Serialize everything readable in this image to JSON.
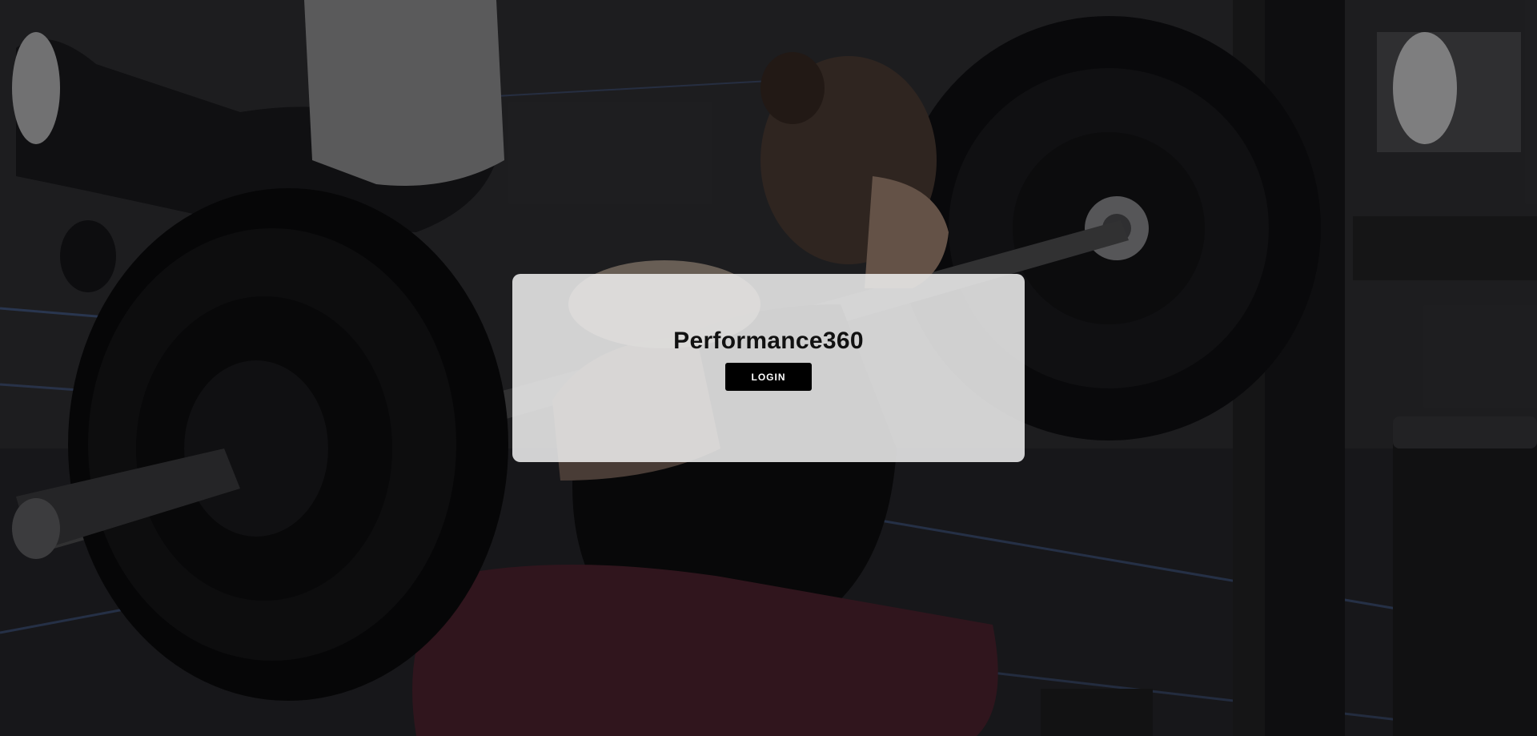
{
  "app": {
    "title": "Performance360"
  },
  "actions": {
    "login_label": "LOGIN"
  },
  "background": {
    "subject": "athlete squatting with loaded barbell in gym",
    "icon": "gym-photo-background"
  },
  "colors": {
    "card_background": "#ececec",
    "button_background": "#000000",
    "button_text": "#ffffff",
    "title_text": "#111111"
  }
}
